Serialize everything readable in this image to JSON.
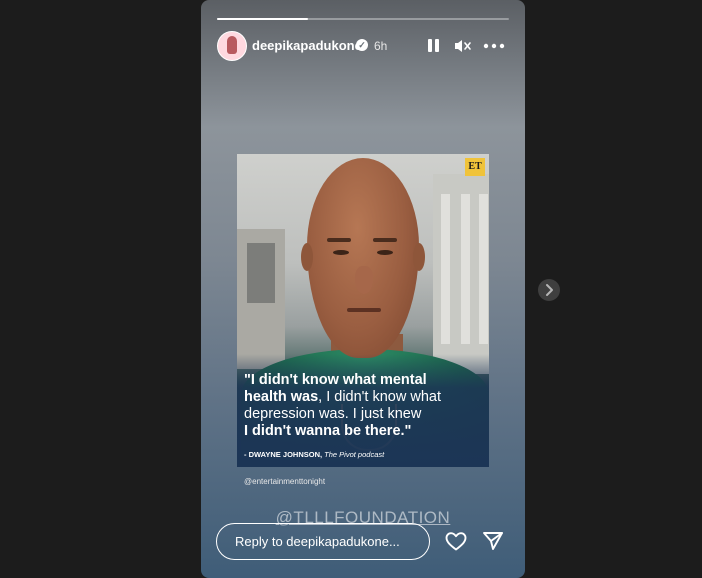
{
  "story": {
    "progress": 0.31,
    "username": "deepikapadukone",
    "verified_badge": "verified-check-icon",
    "time_ago": "6h",
    "header_icons": [
      "pause-icon",
      "mute-icon",
      "more-icon"
    ]
  },
  "media": {
    "logo_text": "ET",
    "quote_line1": "\"I didn't know what mental",
    "quote_bold2": "health was",
    "quote_rest2": ", I didn't know what",
    "quote_line3": "depression was. I just knew",
    "quote_line4": "I didn't wanna be there.\"",
    "attribution_name": "- DWAYNE JOHNSON,",
    "attribution_source": "The Pivot podcast",
    "credit": "@entertainmenttonight"
  },
  "mention": "@TLLLFOUNDATION",
  "reply": {
    "placeholder": "Reply to deepikapadukone..."
  },
  "actions": {
    "like_icon": "heart-icon",
    "share_icon": "paper-plane-icon"
  },
  "navigation": {
    "next_icon": "chevron-right-icon"
  },
  "colors": {
    "page_background": "#1c1c1c",
    "et_yellow": "#f0c33a",
    "shirt_green": "#1f6d50"
  }
}
